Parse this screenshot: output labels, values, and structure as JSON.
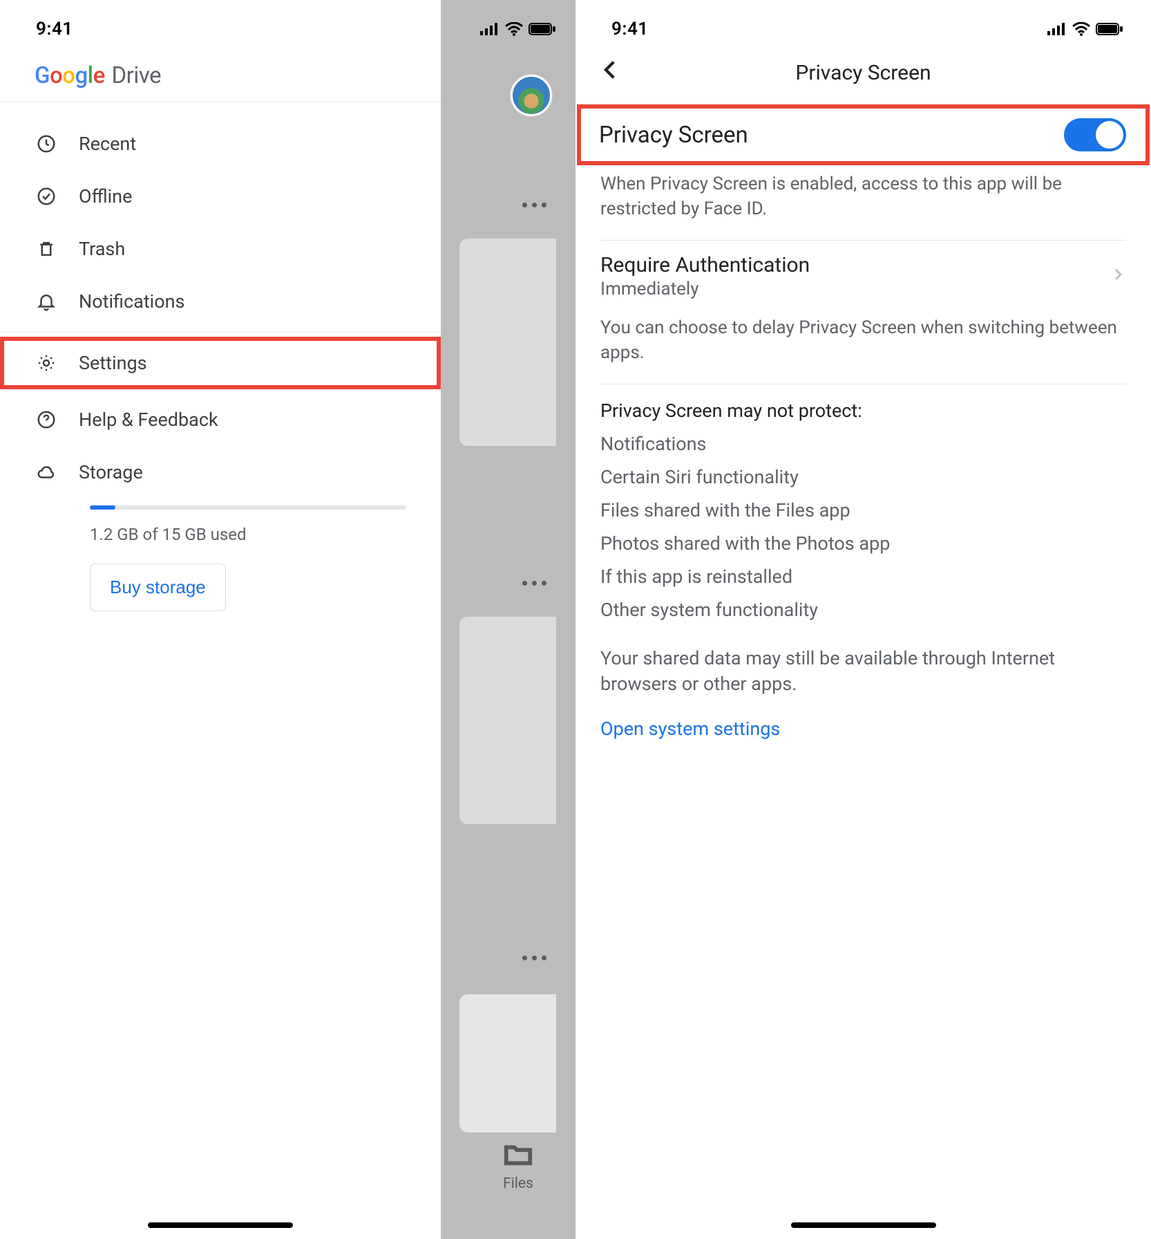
{
  "status": {
    "time": "9:41"
  },
  "left": {
    "logo": {
      "google": "Google",
      "drive": "Drive"
    },
    "menu": {
      "recent": "Recent",
      "offline": "Offline",
      "trash": "Trash",
      "notifications": "Notifications",
      "settings": "Settings",
      "help": "Help & Feedback",
      "storage_label": "Storage"
    },
    "storage": {
      "usage_text": "1.2 GB of 15 GB used",
      "buy_label": "Buy storage",
      "percent": 8
    },
    "files_tab": "Files"
  },
  "right": {
    "title": "Privacy Screen",
    "toggle": {
      "label": "Privacy Screen",
      "on": true
    },
    "toggle_desc": "When Privacy Screen is enabled, access to this app will be restricted by Face ID.",
    "auth": {
      "title": "Require Authentication",
      "value": "Immediately"
    },
    "auth_desc": "You can choose to delay Privacy Screen when switching between apps.",
    "not_protect_label": "Privacy Screen may not protect:",
    "not_protect_items": [
      "Notifications",
      "Certain Siri functionality",
      "Files shared with the Files app",
      "Photos shared with the Photos app",
      "If this app is reinstalled",
      "Other system functionality"
    ],
    "shared_note": "Your shared data may still be available through Internet browsers or other apps.",
    "open_settings": "Open system settings"
  }
}
